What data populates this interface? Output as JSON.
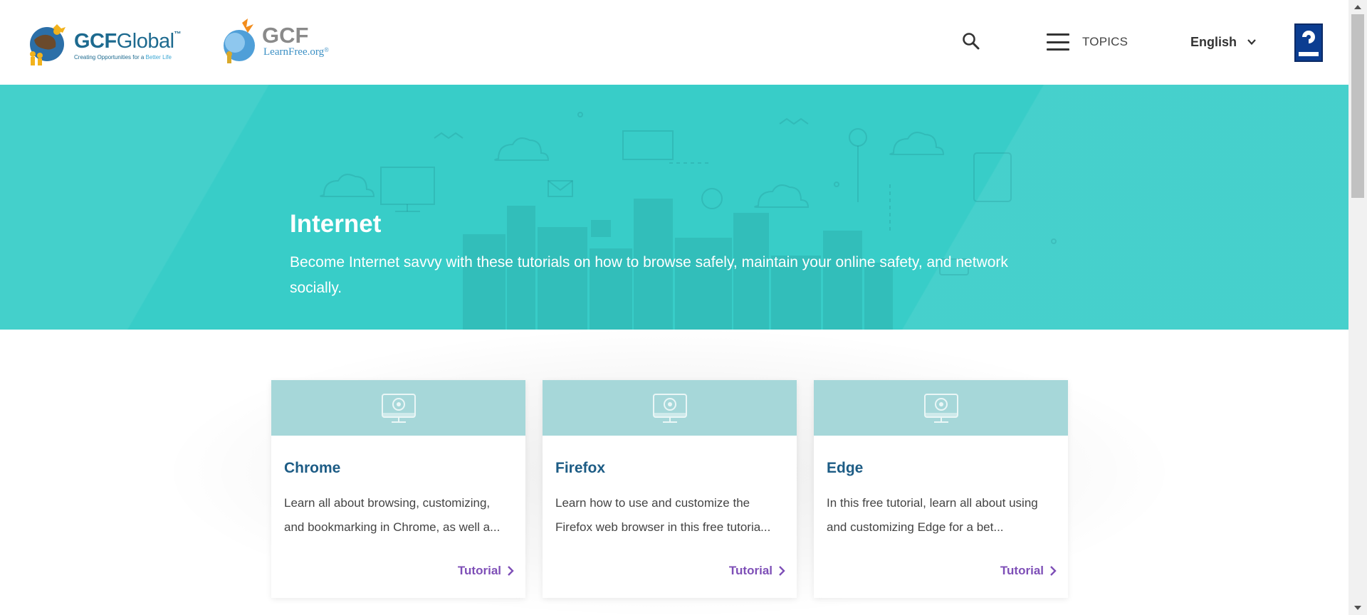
{
  "header": {
    "gcf_logo": {
      "main_bold": "GCF",
      "main_light": "Global",
      "tm": "™",
      "tagline_a": "Creating Opportunities for a ",
      "tagline_b": "Better Life"
    },
    "learnfree_logo": {
      "main": "GCF",
      "sub": "LearnFree.org",
      "reg": "®"
    },
    "search_icon": "search-icon",
    "topics_label": "TOPICS",
    "language_label": "English",
    "partner_logo": "goodwill"
  },
  "hero": {
    "title": "Internet",
    "description": "Become Internet savvy with these tutorials on how to browse safely, maintain your online safety, and network socially.",
    "bg_color": "#38cdc8"
  },
  "cards": [
    {
      "title": "Chrome",
      "description": "Learn all about browsing, customizing, and bookmarking in Chrome, as well a...",
      "link_label": "Tutorial"
    },
    {
      "title": "Firefox",
      "description": "Learn how to use and customize the Firefox web browser in this free tutoria...",
      "link_label": "Tutorial"
    },
    {
      "title": "Edge",
      "description": "In this free tutorial, learn all about using and customizing Edge for a bet...",
      "link_label": "Tutorial"
    }
  ],
  "colors": {
    "card_thumb": "#a6d7d9",
    "card_title": "#1d5c85",
    "link": "#7e4fb7"
  }
}
